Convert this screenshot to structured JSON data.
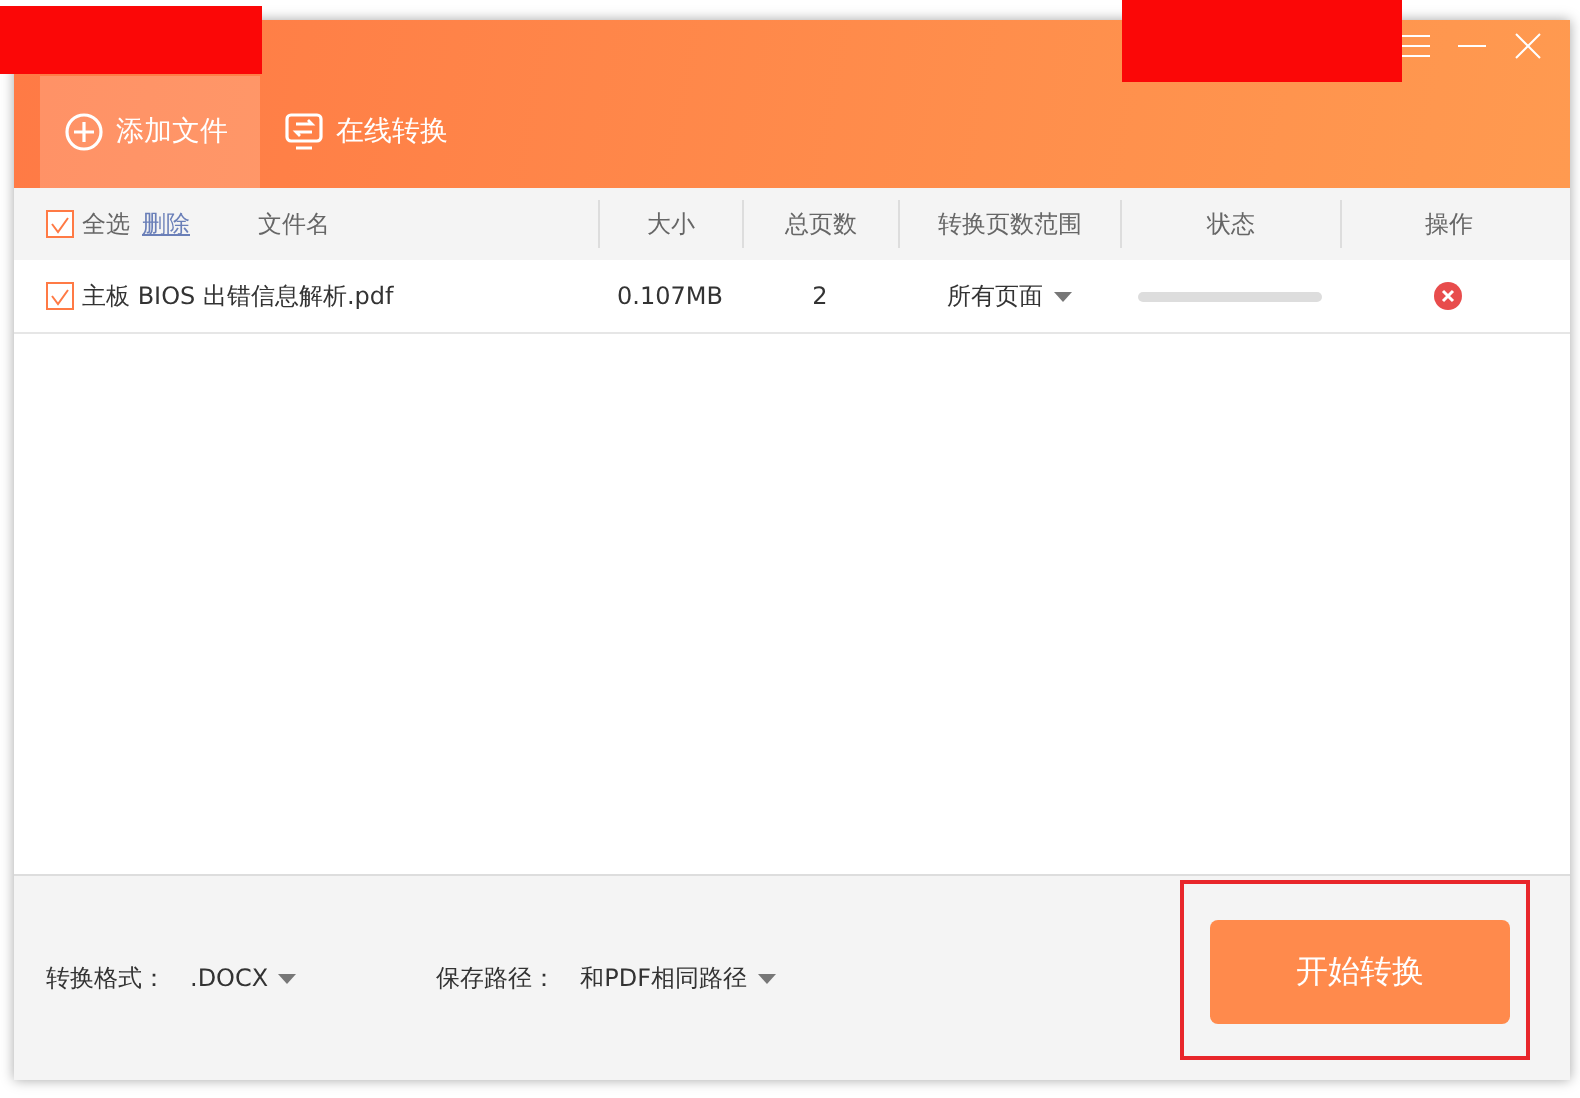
{
  "toolbar": {
    "items": [
      {
        "label": "添加文件",
        "kind": "add",
        "selected": true
      },
      {
        "label": "在线转换",
        "kind": "convert",
        "selected": false
      }
    ]
  },
  "table": {
    "select_all": {
      "label": "全选",
      "checked": true
    },
    "delete_link": "删除",
    "columns": [
      "文件名",
      "大小",
      "总页数",
      "转换页数范围",
      "状态",
      "操作"
    ],
    "rows": [
      {
        "checked": true,
        "name": "主板 BIOS 出错信息解析.pdf",
        "size": "0.107MB",
        "pages": "2",
        "range": "所有页面",
        "level": 0
      }
    ]
  },
  "footer": {
    "format_label": "转换格式：",
    "format": ".DOCX",
    "path_label": "保存路径：",
    "path": "和PDF相同路径",
    "start_button": "开始转换"
  }
}
